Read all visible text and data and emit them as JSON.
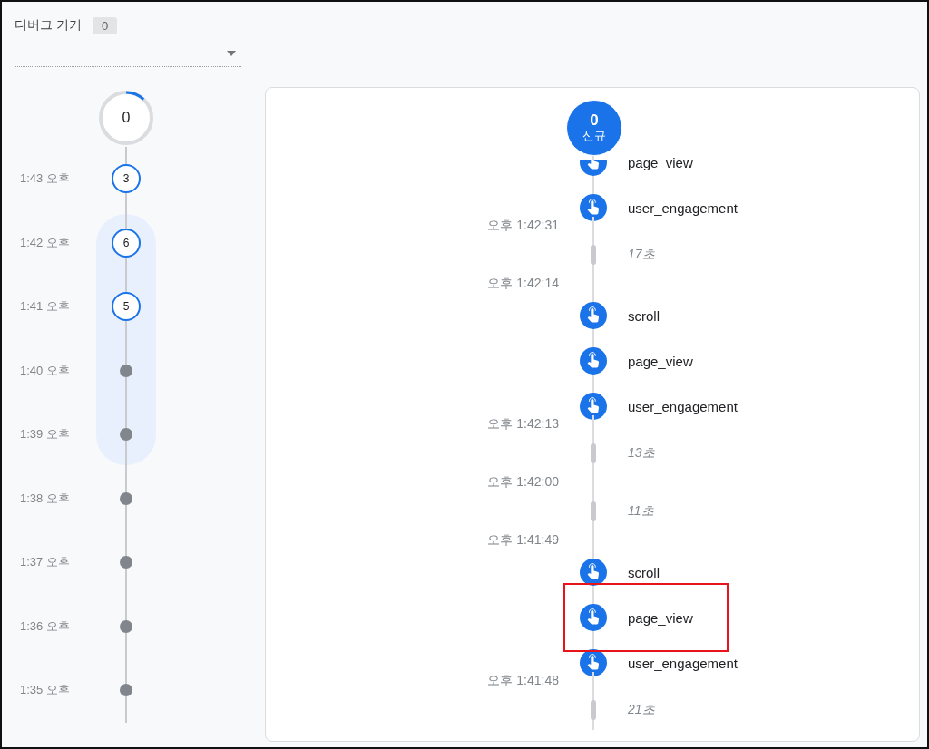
{
  "device": {
    "label": "디버그 기기",
    "count": "0"
  },
  "minutes": {
    "total": "0",
    "level": 0.12,
    "rows": [
      {
        "time": "1:43 오후",
        "kind": "count",
        "count": "3",
        "selected": false
      },
      {
        "time": "1:42 오후",
        "kind": "count",
        "count": "6",
        "selected": true
      },
      {
        "time": "1:41 오후",
        "kind": "count",
        "count": "5",
        "selected": true
      },
      {
        "time": "1:40 오후",
        "kind": "empty",
        "selected": true
      },
      {
        "time": "1:39 오후",
        "kind": "empty",
        "selected": true
      },
      {
        "time": "1:38 오후",
        "kind": "empty",
        "selected": false
      },
      {
        "time": "1:37 오후",
        "kind": "empty",
        "selected": false
      },
      {
        "time": "1:36 오후",
        "kind": "empty",
        "selected": false
      },
      {
        "time": "1:35 오후",
        "kind": "empty",
        "selected": false
      }
    ]
  },
  "stream": {
    "top": {
      "count": "0",
      "label": "신규"
    },
    "items": [
      {
        "kind": "event",
        "name": "page_view",
        "highlighted": false
      },
      {
        "kind": "event",
        "name": "user_engagement",
        "highlighted": false
      },
      {
        "kind": "time",
        "text": "오후 1:42:31"
      },
      {
        "kind": "gap",
        "text": "17초"
      },
      {
        "kind": "time",
        "text": "오후 1:42:14"
      },
      {
        "kind": "event",
        "name": "scroll",
        "highlighted": false
      },
      {
        "kind": "event",
        "name": "page_view",
        "highlighted": false
      },
      {
        "kind": "event",
        "name": "user_engagement",
        "highlighted": false
      },
      {
        "kind": "time",
        "text": "오후 1:42:13"
      },
      {
        "kind": "gap",
        "text": "13초"
      },
      {
        "kind": "time",
        "text": "오후 1:42:00"
      },
      {
        "kind": "gap",
        "text": "11초"
      },
      {
        "kind": "time",
        "text": "오후 1:41:49"
      },
      {
        "kind": "event",
        "name": "scroll",
        "highlighted": false
      },
      {
        "kind": "event",
        "name": "page_view",
        "highlighted": true
      },
      {
        "kind": "event",
        "name": "user_engagement",
        "highlighted": false
      },
      {
        "kind": "time",
        "text": "오후 1:41:48"
      },
      {
        "kind": "gap",
        "text": "21초"
      }
    ]
  }
}
